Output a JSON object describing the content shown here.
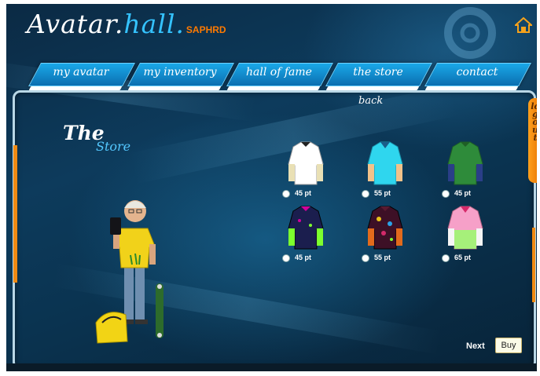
{
  "header": {
    "logo_avatar": "Avatar.",
    "logo_hall": "hall.",
    "logo_brand": "SAPHRD",
    "home_icon": "home-icon"
  },
  "nav": {
    "tabs": [
      {
        "label": "my avatar"
      },
      {
        "label": "my inventory"
      },
      {
        "label": "hall of fame"
      },
      {
        "label": "the store"
      },
      {
        "label": "contact"
      }
    ],
    "back_label": "back",
    "logout_label": "logout"
  },
  "store": {
    "title_the": "The",
    "title_store": "Store",
    "items": [
      {
        "name": "white-shirt",
        "price": "45 pt",
        "body_color": "#ffffff",
        "sleeve_color": "#e9e0b5",
        "collar_color": "#222222"
      },
      {
        "name": "cyan-polo",
        "price": "55 pt",
        "body_color": "#2fd6ee",
        "sleeve_color": "#f2c28a",
        "collar_color": "#1a5c88"
      },
      {
        "name": "green-shirt",
        "price": "45 pt",
        "body_color": "#2e8b3a",
        "sleeve_color": "#2a3e88",
        "collar_color": "#1f5f25"
      },
      {
        "name": "navy-neon-shirt",
        "price": "45 pt",
        "body_color": "#1b1e4e",
        "sleeve_color": "#7dff2e",
        "collar_color": "#d4009a"
      },
      {
        "name": "maroon-dotted-shirt",
        "price": "55 pt",
        "body_color": "#3d1026",
        "sleeve_color": "#e26a1c",
        "collar_color": "#5a1a30"
      },
      {
        "name": "pink-green-polo",
        "price": "65 pt",
        "body_color": "#f6a0c8",
        "sleeve_color": "#f5f5f5",
        "collar_color": "#d62a6a"
      }
    ],
    "next_label": "Next",
    "buy_label": "Buy"
  }
}
